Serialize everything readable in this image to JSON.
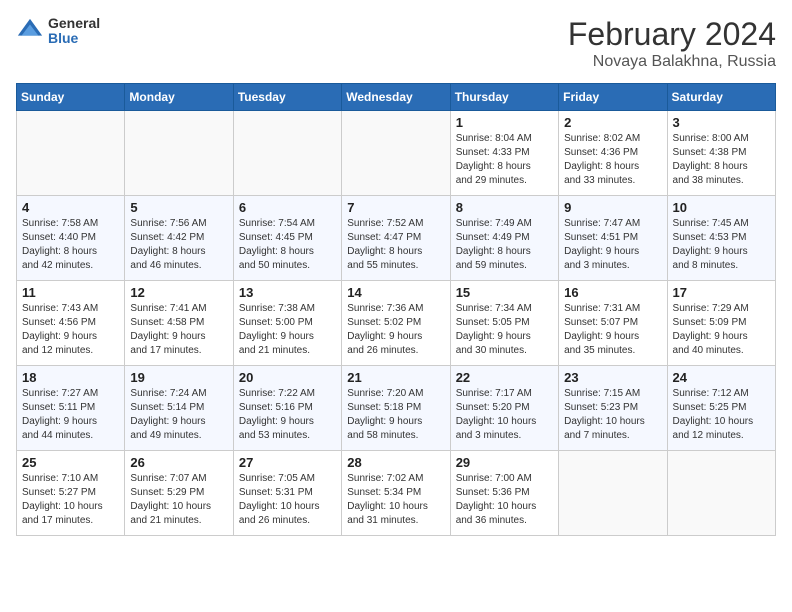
{
  "logo": {
    "general": "General",
    "blue": "Blue"
  },
  "title": "February 2024",
  "location": "Novaya Balakhna, Russia",
  "days_of_week": [
    "Sunday",
    "Monday",
    "Tuesday",
    "Wednesday",
    "Thursday",
    "Friday",
    "Saturday"
  ],
  "weeks": [
    [
      {
        "day": "",
        "info": ""
      },
      {
        "day": "",
        "info": ""
      },
      {
        "day": "",
        "info": ""
      },
      {
        "day": "",
        "info": ""
      },
      {
        "day": "1",
        "info": "Sunrise: 8:04 AM\nSunset: 4:33 PM\nDaylight: 8 hours\nand 29 minutes."
      },
      {
        "day": "2",
        "info": "Sunrise: 8:02 AM\nSunset: 4:36 PM\nDaylight: 8 hours\nand 33 minutes."
      },
      {
        "day": "3",
        "info": "Sunrise: 8:00 AM\nSunset: 4:38 PM\nDaylight: 8 hours\nand 38 minutes."
      }
    ],
    [
      {
        "day": "4",
        "info": "Sunrise: 7:58 AM\nSunset: 4:40 PM\nDaylight: 8 hours\nand 42 minutes."
      },
      {
        "day": "5",
        "info": "Sunrise: 7:56 AM\nSunset: 4:42 PM\nDaylight: 8 hours\nand 46 minutes."
      },
      {
        "day": "6",
        "info": "Sunrise: 7:54 AM\nSunset: 4:45 PM\nDaylight: 8 hours\nand 50 minutes."
      },
      {
        "day": "7",
        "info": "Sunrise: 7:52 AM\nSunset: 4:47 PM\nDaylight: 8 hours\nand 55 minutes."
      },
      {
        "day": "8",
        "info": "Sunrise: 7:49 AM\nSunset: 4:49 PM\nDaylight: 8 hours\nand 59 minutes."
      },
      {
        "day": "9",
        "info": "Sunrise: 7:47 AM\nSunset: 4:51 PM\nDaylight: 9 hours\nand 3 minutes."
      },
      {
        "day": "10",
        "info": "Sunrise: 7:45 AM\nSunset: 4:53 PM\nDaylight: 9 hours\nand 8 minutes."
      }
    ],
    [
      {
        "day": "11",
        "info": "Sunrise: 7:43 AM\nSunset: 4:56 PM\nDaylight: 9 hours\nand 12 minutes."
      },
      {
        "day": "12",
        "info": "Sunrise: 7:41 AM\nSunset: 4:58 PM\nDaylight: 9 hours\nand 17 minutes."
      },
      {
        "day": "13",
        "info": "Sunrise: 7:38 AM\nSunset: 5:00 PM\nDaylight: 9 hours\nand 21 minutes."
      },
      {
        "day": "14",
        "info": "Sunrise: 7:36 AM\nSunset: 5:02 PM\nDaylight: 9 hours\nand 26 minutes."
      },
      {
        "day": "15",
        "info": "Sunrise: 7:34 AM\nSunset: 5:05 PM\nDaylight: 9 hours\nand 30 minutes."
      },
      {
        "day": "16",
        "info": "Sunrise: 7:31 AM\nSunset: 5:07 PM\nDaylight: 9 hours\nand 35 minutes."
      },
      {
        "day": "17",
        "info": "Sunrise: 7:29 AM\nSunset: 5:09 PM\nDaylight: 9 hours\nand 40 minutes."
      }
    ],
    [
      {
        "day": "18",
        "info": "Sunrise: 7:27 AM\nSunset: 5:11 PM\nDaylight: 9 hours\nand 44 minutes."
      },
      {
        "day": "19",
        "info": "Sunrise: 7:24 AM\nSunset: 5:14 PM\nDaylight: 9 hours\nand 49 minutes."
      },
      {
        "day": "20",
        "info": "Sunrise: 7:22 AM\nSunset: 5:16 PM\nDaylight: 9 hours\nand 53 minutes."
      },
      {
        "day": "21",
        "info": "Sunrise: 7:20 AM\nSunset: 5:18 PM\nDaylight: 9 hours\nand 58 minutes."
      },
      {
        "day": "22",
        "info": "Sunrise: 7:17 AM\nSunset: 5:20 PM\nDaylight: 10 hours\nand 3 minutes."
      },
      {
        "day": "23",
        "info": "Sunrise: 7:15 AM\nSunset: 5:23 PM\nDaylight: 10 hours\nand 7 minutes."
      },
      {
        "day": "24",
        "info": "Sunrise: 7:12 AM\nSunset: 5:25 PM\nDaylight: 10 hours\nand 12 minutes."
      }
    ],
    [
      {
        "day": "25",
        "info": "Sunrise: 7:10 AM\nSunset: 5:27 PM\nDaylight: 10 hours\nand 17 minutes."
      },
      {
        "day": "26",
        "info": "Sunrise: 7:07 AM\nSunset: 5:29 PM\nDaylight: 10 hours\nand 21 minutes."
      },
      {
        "day": "27",
        "info": "Sunrise: 7:05 AM\nSunset: 5:31 PM\nDaylight: 10 hours\nand 26 minutes."
      },
      {
        "day": "28",
        "info": "Sunrise: 7:02 AM\nSunset: 5:34 PM\nDaylight: 10 hours\nand 31 minutes."
      },
      {
        "day": "29",
        "info": "Sunrise: 7:00 AM\nSunset: 5:36 PM\nDaylight: 10 hours\nand 36 minutes."
      },
      {
        "day": "",
        "info": ""
      },
      {
        "day": "",
        "info": ""
      }
    ]
  ]
}
